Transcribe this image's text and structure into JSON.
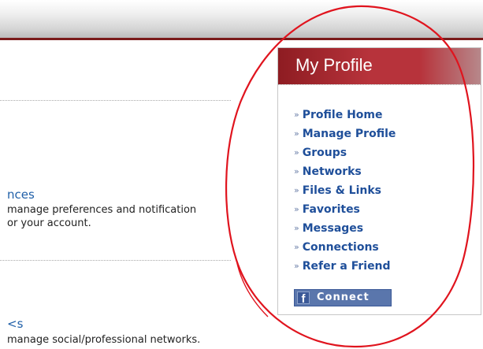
{
  "main": {
    "sections": [
      {
        "title": "nces",
        "lines": [
          "manage preferences and notification",
          "or your account."
        ]
      },
      {
        "title": "<s",
        "lines": [
          "manage social/professional networks."
        ]
      }
    ]
  },
  "profile": {
    "title": "My Profile",
    "menu": [
      {
        "label": "Profile Home"
      },
      {
        "label": "Manage Profile"
      },
      {
        "label": "Groups"
      },
      {
        "label": "Networks"
      },
      {
        "label": "Files & Links"
      },
      {
        "label": "Favorites"
      },
      {
        "label": "Messages"
      },
      {
        "label": "Connections"
      },
      {
        "label": "Refer a Friend"
      }
    ],
    "bullet_glyph": "»",
    "connect": {
      "logo": "f",
      "label": "Connect",
      "icon": "facebook-icon"
    }
  },
  "colors": {
    "header_red": "#b7333b",
    "link_blue": "#1f4f9a",
    "section_blue": "#1f5fa8",
    "facebook_blue": "#3b5998",
    "annotation_red": "#e0141e"
  }
}
